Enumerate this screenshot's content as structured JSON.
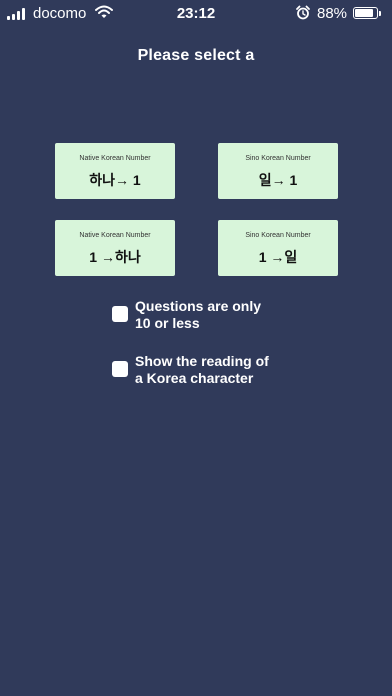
{
  "status_bar": {
    "carrier": "docomo",
    "time": "23:12",
    "battery_percent_label": "88%",
    "battery_level": 0.88
  },
  "screen": {
    "title": "Please select a"
  },
  "modes": [
    {
      "subtitle": "Native Korean Number",
      "label": "하나→ 1"
    },
    {
      "subtitle": "Sino Korean Number",
      "label": "일→ 1"
    },
    {
      "subtitle": "Native Korean Number",
      "label": "1 →하나"
    },
    {
      "subtitle": "Sino Korean Number",
      "label": "1 →일"
    }
  ],
  "options": [
    {
      "line1": "Questions are only",
      "line2": "10 or less",
      "checked": false
    },
    {
      "line1": "Show the reading of",
      "line2": "a Korea character",
      "checked": false
    }
  ],
  "colors": {
    "background": "#303a5a",
    "card": "#d8f5da",
    "text": "#ffffff"
  }
}
